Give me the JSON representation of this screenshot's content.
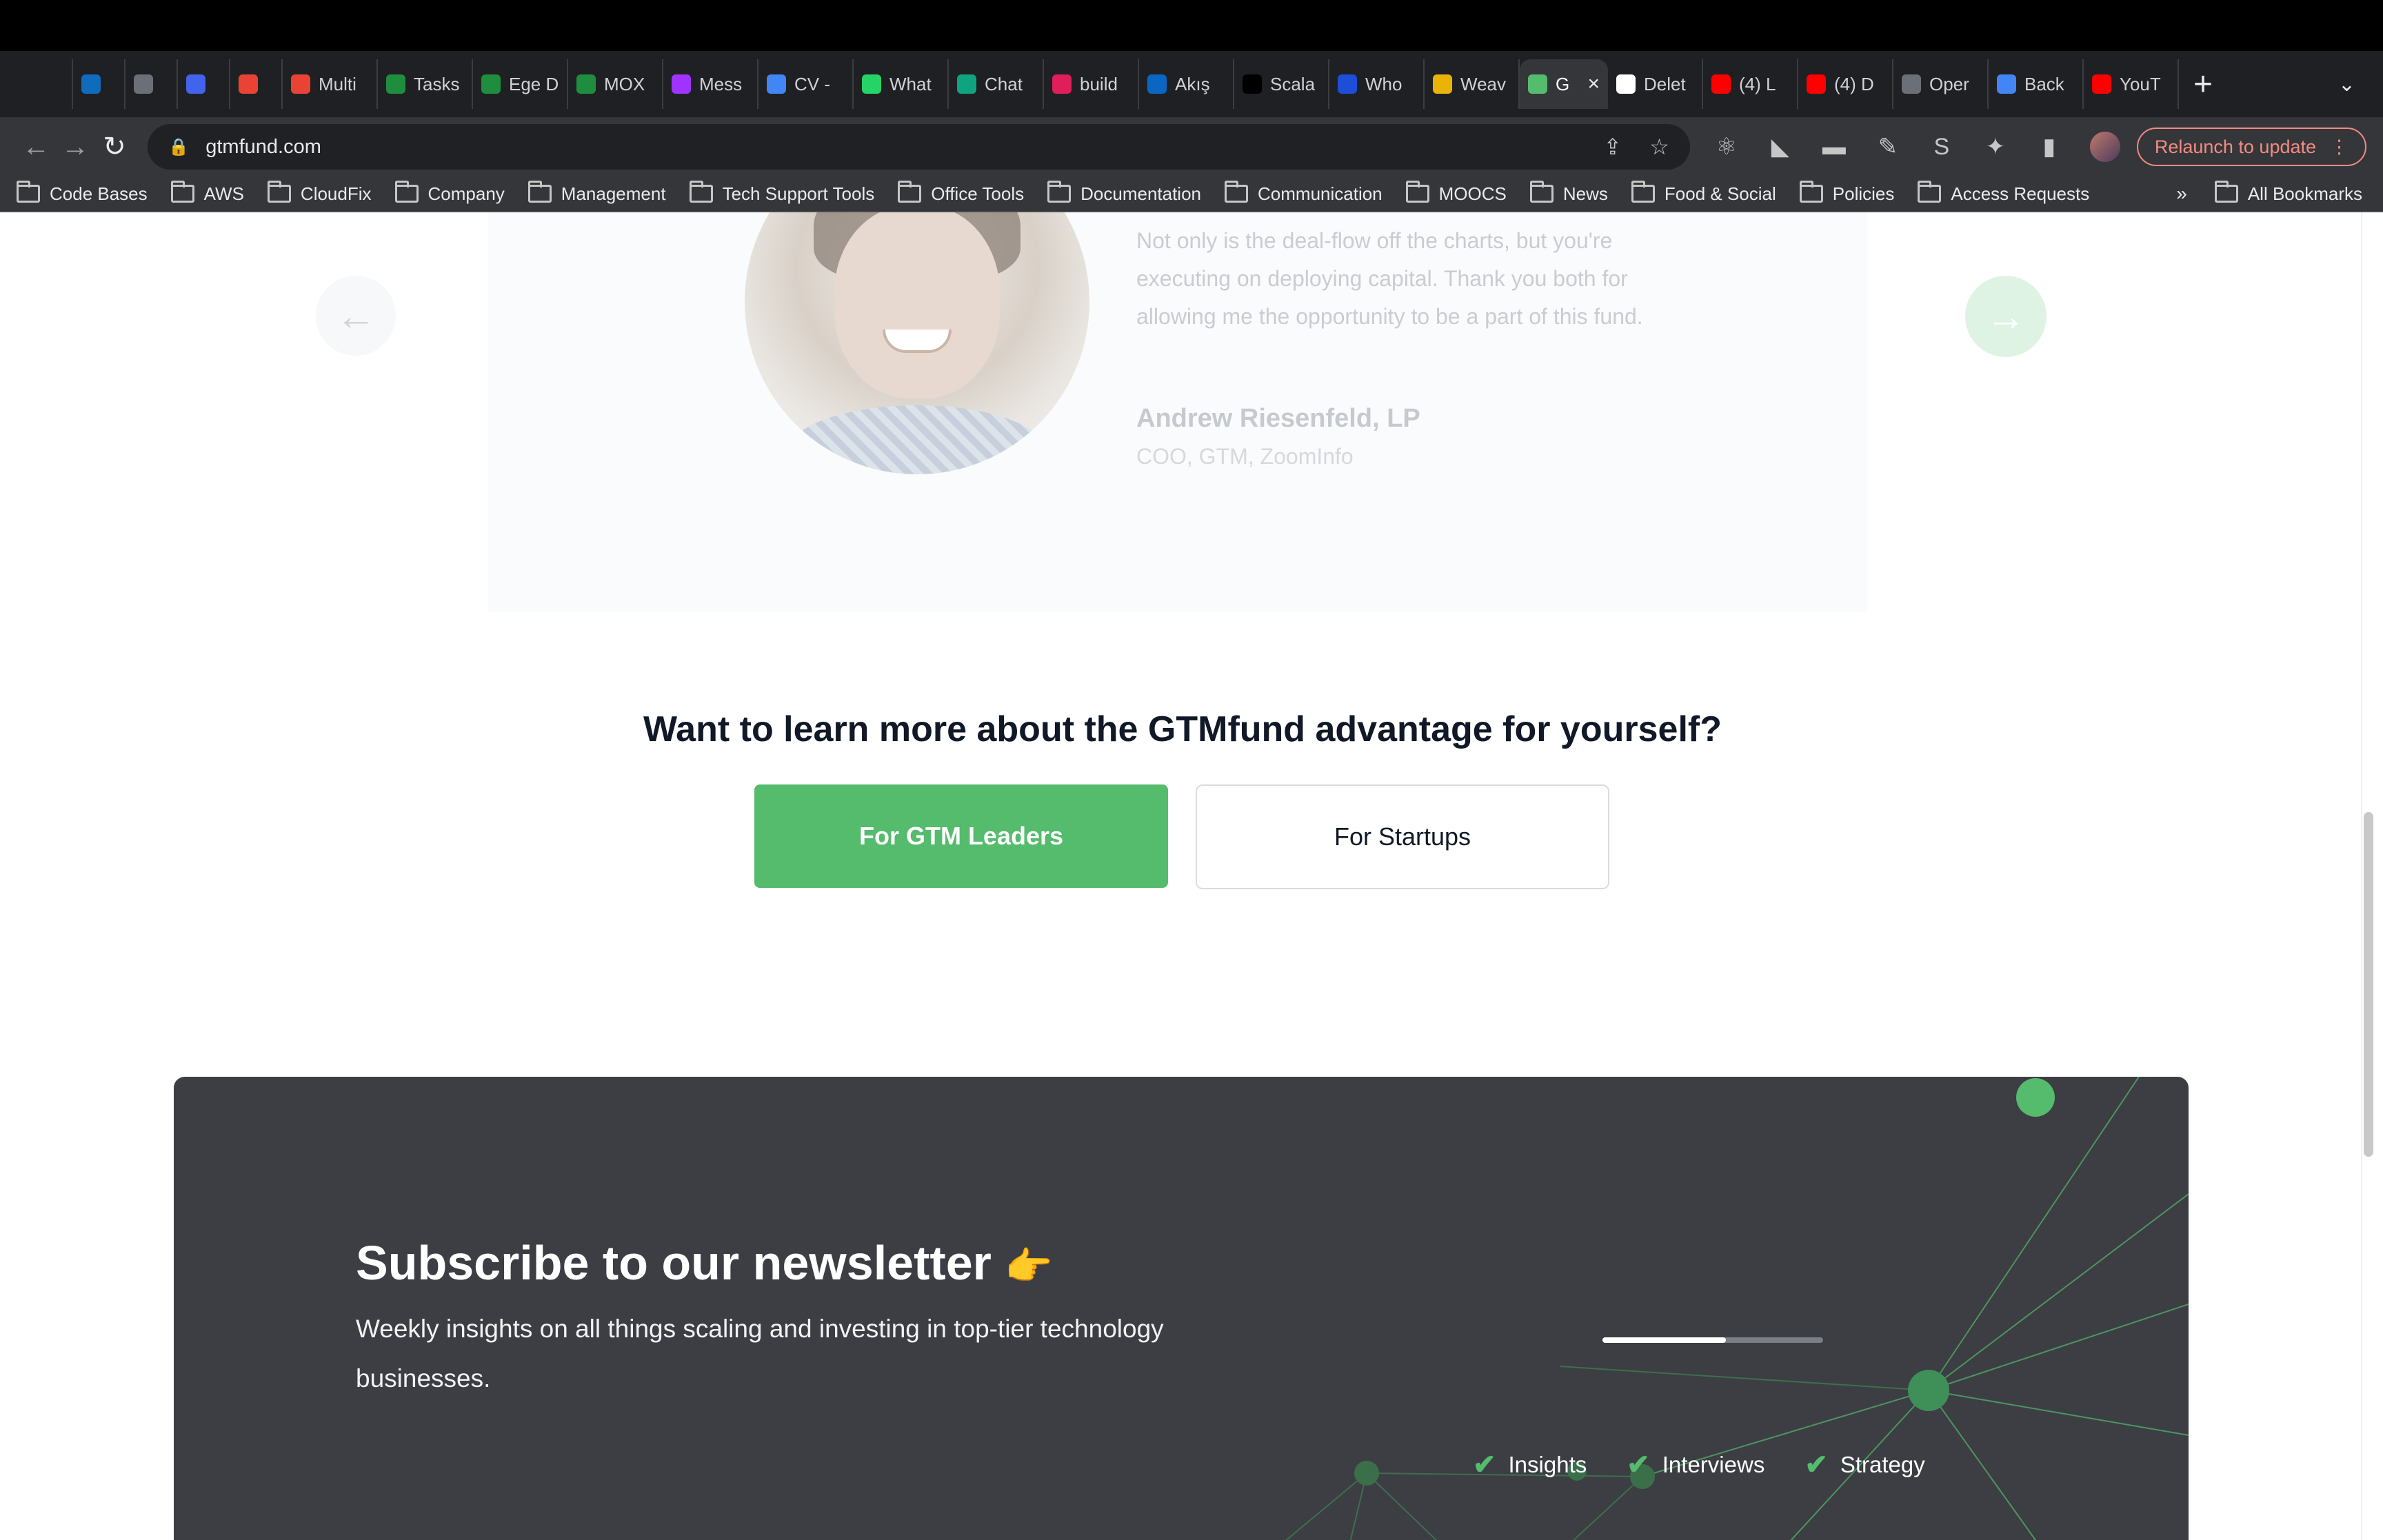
{
  "browser": {
    "tabs": [
      {
        "title": "",
        "favicon": "apps-icon",
        "color": "#1f2023"
      },
      {
        "title": "",
        "favicon": "outlook-icon",
        "color": "#0f6cbd"
      },
      {
        "title": "",
        "favicon": "circle-logo-icon",
        "color": "#6b6f78"
      },
      {
        "title": "",
        "favicon": "power-icon",
        "color": "#4263eb"
      },
      {
        "title": "",
        "favicon": "gmail-icon",
        "color": "#ea4335"
      },
      {
        "title": "Multi",
        "favicon": "gmail-icon",
        "color": "#ea4335"
      },
      {
        "title": "Tasks",
        "favicon": "tasks-icon",
        "color": "#1e8e3e"
      },
      {
        "title": "Ege D",
        "favicon": "sheets-icon",
        "color": "#1e8e3e"
      },
      {
        "title": "MOX",
        "favicon": "sheets-icon",
        "color": "#1e8e3e"
      },
      {
        "title": "Mess",
        "favicon": "messenger-icon",
        "color": "#a033ff"
      },
      {
        "title": "CV -",
        "favicon": "docs-icon",
        "color": "#4285f4"
      },
      {
        "title": "What",
        "favicon": "whatsapp-icon",
        "color": "#25d366"
      },
      {
        "title": "Chat",
        "favicon": "openai-icon",
        "color": "#10a37f"
      },
      {
        "title": "build",
        "favicon": "slack-icon",
        "color": "#e01e5a"
      },
      {
        "title": "Akış",
        "favicon": "linkedin-icon",
        "color": "#0a66c2"
      },
      {
        "title": "Scala",
        "favicon": "medium-icon",
        "color": "#000000"
      },
      {
        "title": "Who",
        "favicon": "check-logo-icon",
        "color": "#1d4ed8"
      },
      {
        "title": "Weav",
        "favicon": "weave-icon",
        "color": "#eab308"
      },
      {
        "title": "G",
        "favicon": "gtmfund-icon",
        "color": "#55bb6d",
        "active": true
      },
      {
        "title": "Delet",
        "favicon": "github-icon",
        "color": "#ffffff"
      },
      {
        "title": "(4) L",
        "favicon": "youtube-icon",
        "color": "#ff0000"
      },
      {
        "title": "(4) D",
        "favicon": "youtube-icon",
        "color": "#ff0000"
      },
      {
        "title": "Oper",
        "favicon": "openai-icon",
        "color": "#6b6f78"
      },
      {
        "title": "Back",
        "favicon": "docs-icon",
        "color": "#4285f4"
      },
      {
        "title": "YouT",
        "favicon": "youtube-icon",
        "color": "#ff0000"
      }
    ],
    "url": "gtmfund.com",
    "relaunch_label": "Relaunch to update",
    "bookmarks": [
      "Code Bases",
      "AWS",
      "CloudFix",
      "Company",
      "Management",
      "Tech Support Tools",
      "Office Tools",
      "Documentation",
      "Communication",
      "MOOCS",
      "News",
      "Food & Social",
      "Policies",
      "Access Requests"
    ],
    "bookmarks_overflow": "»",
    "all_bookmarks_label": "All Bookmarks"
  },
  "testimonial": {
    "quote": "Not only is the deal-flow off the charts, but you're executing on deploying capital. Thank you both for allowing me the opportunity to be a part of this fund.",
    "name": "Andrew Riesenfeld, LP",
    "role": "COO, GTM, ZoomInfo",
    "prev_arrow": "←",
    "next_arrow": "→"
  },
  "cta": {
    "heading": "Want to learn more about the GTMfund advantage for yourself?",
    "leaders_button": "For GTM Leaders",
    "startups_button": "For Startups",
    "accent_color": "#55bb6d"
  },
  "newsletter": {
    "title": "Subscribe to our newsletter",
    "title_icon": "👉",
    "subtitle": "Weekly insights on all things scaling and investing in top-tier technology businesses.",
    "progress_fraction": 0.56,
    "features": [
      "Insights",
      "Interviews",
      "Strategy"
    ],
    "background_color": "#3c3e43"
  }
}
